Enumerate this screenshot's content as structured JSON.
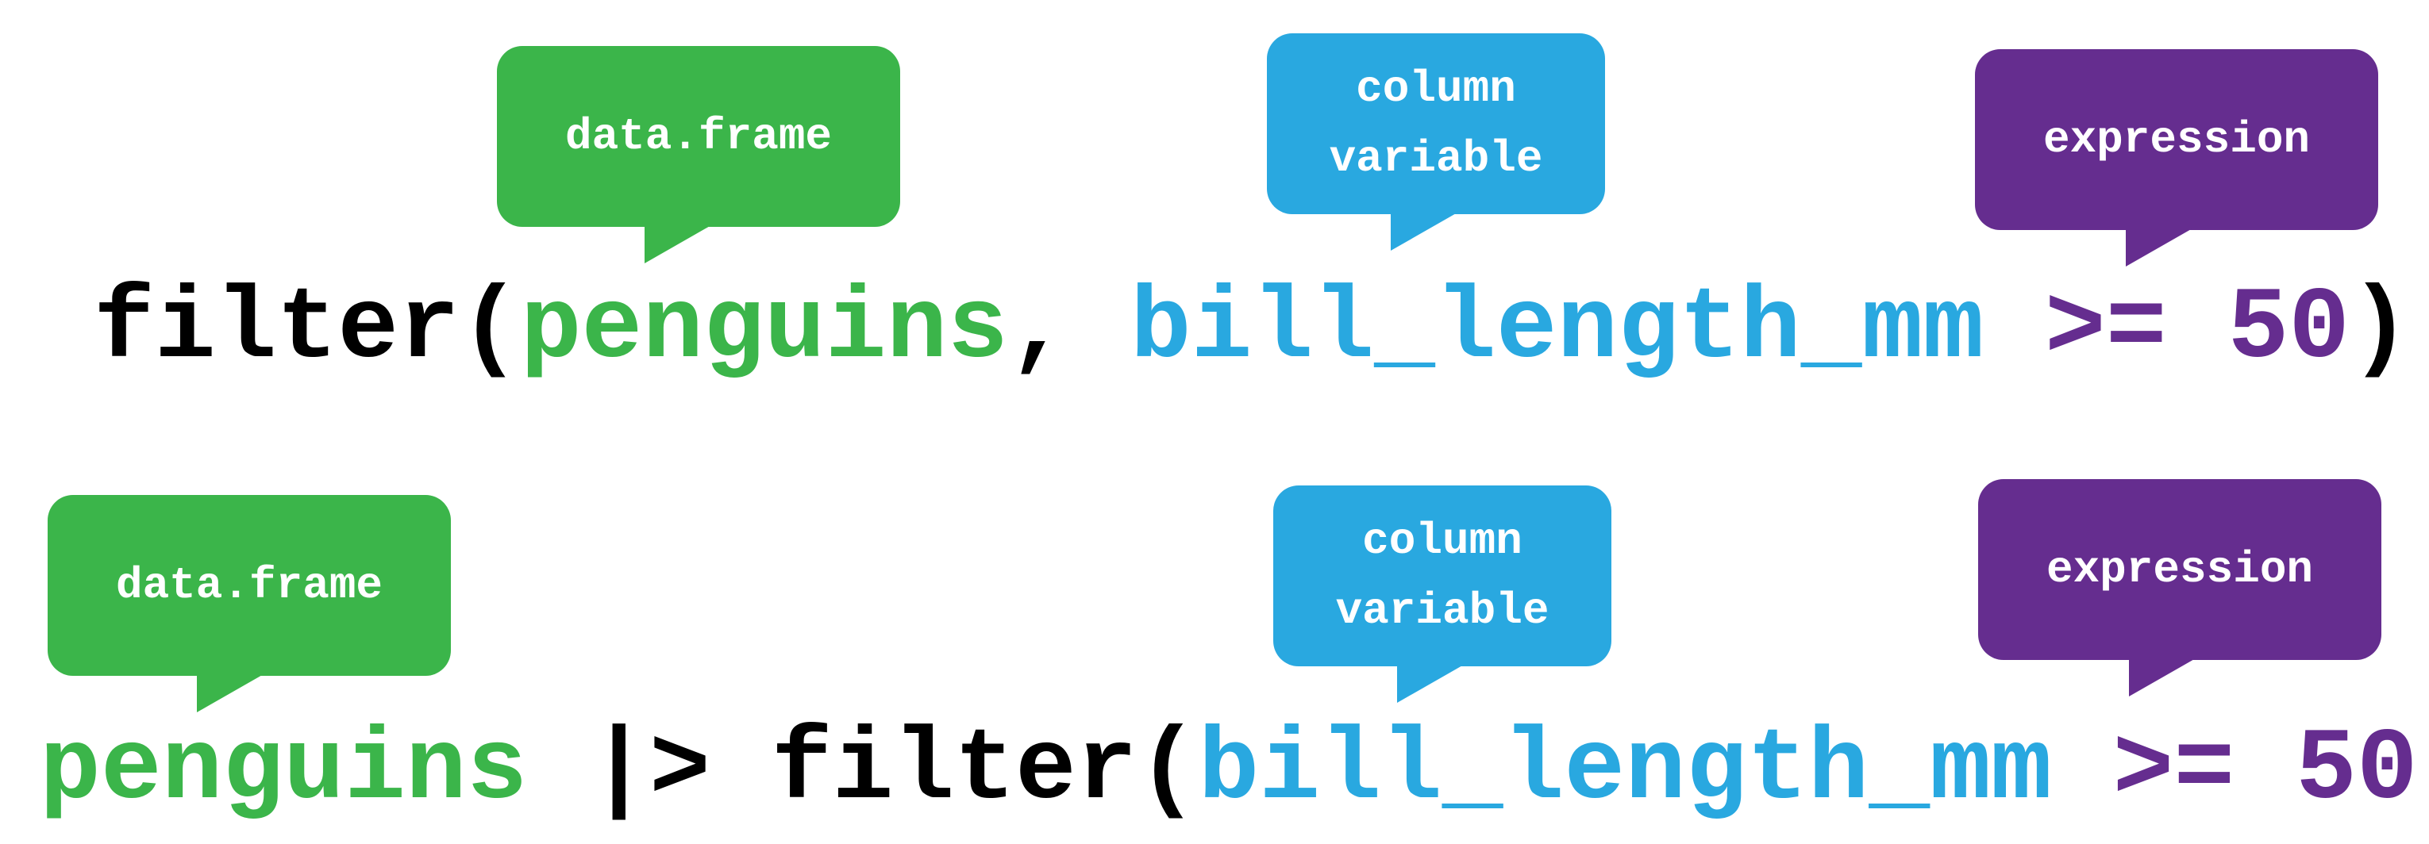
{
  "row1": {
    "bubbles": {
      "dataframe": "data.frame",
      "column_line1": "column",
      "column_line2": "variable",
      "expression": "expression"
    },
    "code": {
      "func": "filter(",
      "data": "penguins",
      "sep": ", ",
      "column": "bill_length_mm",
      "expr": " >= 50",
      "close": ")"
    }
  },
  "row2": {
    "bubbles": {
      "dataframe": "data.frame",
      "column_line1": "column",
      "column_line2": "variable",
      "expression": "expression"
    },
    "code": {
      "data": "penguins",
      "pipe": " |> ",
      "func": "filter(",
      "column": "bill_length_mm",
      "expr": " >= 50",
      "close": ")"
    }
  },
  "colors": {
    "dataframe": "#3bb54a",
    "column": "#29a8e0",
    "expression": "#652d8f",
    "code": "#000000"
  }
}
